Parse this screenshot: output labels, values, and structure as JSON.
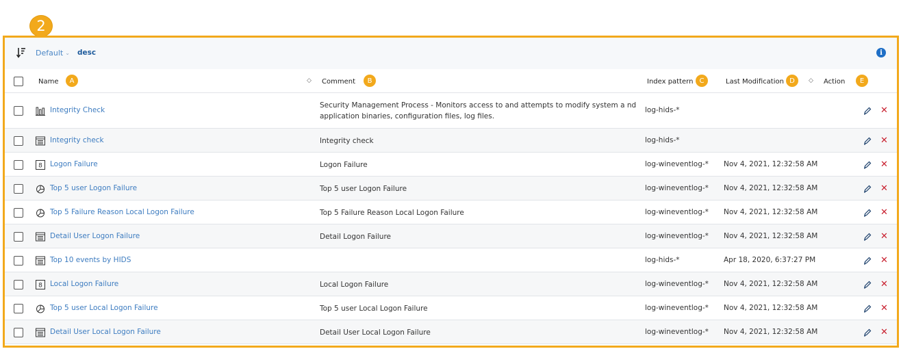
{
  "callout": "2",
  "toolbar": {
    "sort_field": "Default",
    "sort_direction": "desc",
    "sort_icon": "sort-descending-icon",
    "info_icon": "info-icon"
  },
  "columns": {
    "name": "Name",
    "comment": "Comment",
    "index_pattern": "Index pattern",
    "last_modification": "Last Modification",
    "action": "Action"
  },
  "badges": {
    "a": "A",
    "b": "B",
    "c": "C",
    "d": "D",
    "e": "E"
  },
  "rows": [
    {
      "name": "Integrity Check",
      "icon": "bar-chart-icon",
      "comment": "Security Management Process - Monitors access to and attempts to modify system a nd application binaries, configuration files, log files.",
      "index": "log-hids-*",
      "modified": ""
    },
    {
      "name": "Integrity check",
      "icon": "table-icon",
      "comment": "Integrity check",
      "index": "log-hids-*",
      "modified": ""
    },
    {
      "name": "Logon Failure",
      "icon": "metric-icon",
      "comment": "Logon Failure",
      "index": "log-wineventlog-*",
      "modified": "Nov 4, 2021, 12:32:58 AM"
    },
    {
      "name": "Top 5 user Logon Failure",
      "icon": "pie-chart-icon",
      "comment": "Top 5 user Logon Failure",
      "index": "log-wineventlog-*",
      "modified": "Nov 4, 2021, 12:32:58 AM"
    },
    {
      "name": "Top 5 Failure Reason Local Logon Failure",
      "icon": "pie-chart-icon",
      "comment": "Top 5 Failure Reason Local Logon Failure",
      "index": "log-wineventlog-*",
      "modified": "Nov 4, 2021, 12:32:58 AM"
    },
    {
      "name": "Detail User Logon Failure",
      "icon": "table-icon",
      "comment": "Detail Logon Failure",
      "index": "log-wineventlog-*",
      "modified": "Nov 4, 2021, 12:32:58 AM"
    },
    {
      "name": "Top 10 events by HIDS",
      "icon": "table-icon",
      "comment": "",
      "index": "log-hids-*",
      "modified": "Apr 18, 2020, 6:37:27 PM"
    },
    {
      "name": "Local Logon Failure",
      "icon": "metric-icon",
      "comment": "Local Logon Failure",
      "index": "log-wineventlog-*",
      "modified": "Nov 4, 2021, 12:32:58 AM"
    },
    {
      "name": "Top 5 user Local Logon Failure",
      "icon": "pie-chart-icon",
      "comment": "Top 5 user Local Logon Failure",
      "index": "log-wineventlog-*",
      "modified": "Nov 4, 2021, 12:32:58 AM"
    },
    {
      "name": "Detail User Local Logon Failure",
      "icon": "table-icon",
      "comment": "Detail User Local Logon Failure",
      "index": "log-wineventlog-*",
      "modified": "Nov 4, 2021, 12:32:58 AM"
    }
  ],
  "colors": {
    "accent": "#f2a91c",
    "link": "#3d7cc0",
    "delete": "#c8202f",
    "info": "#1f6fc6"
  }
}
